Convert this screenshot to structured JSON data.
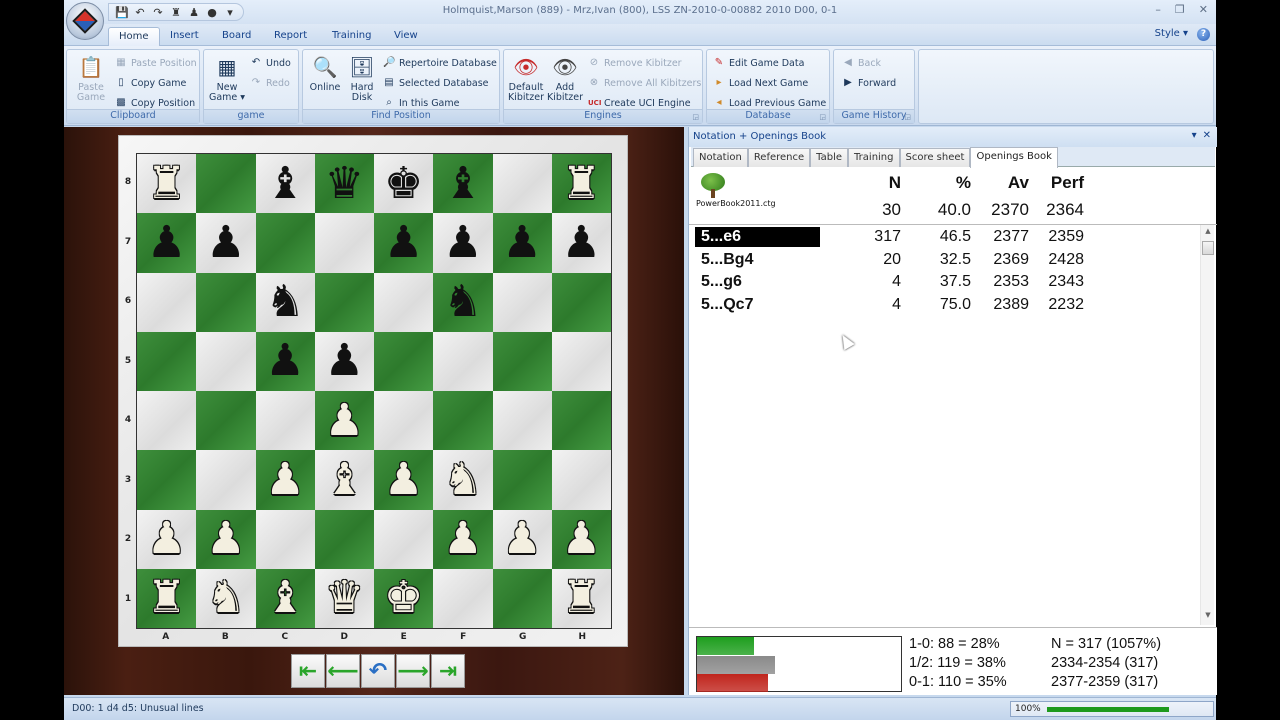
{
  "window": {
    "title": "Holmquist,Marson (889) - Mrz,Ivan (800), LSS ZN-2010-0-00882 2010  D00, 0-1",
    "controls": [
      "minimize",
      "restore",
      "close"
    ]
  },
  "quick_access": [
    {
      "icon": "save-icon",
      "glyph": "💾"
    },
    {
      "icon": "undo-icon",
      "glyph": "↶"
    },
    {
      "icon": "redo-icon",
      "glyph": "↷"
    },
    {
      "icon": "board-icon",
      "glyph": "♜"
    },
    {
      "icon": "piece-icon",
      "glyph": "♟"
    },
    {
      "icon": "bulb-icon",
      "glyph": "●"
    },
    {
      "icon": "customize-icon",
      "glyph": "▾"
    }
  ],
  "ribbon": {
    "tabs": [
      {
        "label": "Home",
        "active": true
      },
      {
        "label": "Insert",
        "active": false
      },
      {
        "label": "Board",
        "active": false
      },
      {
        "label": "Report",
        "active": false
      },
      {
        "label": "Training",
        "active": false
      },
      {
        "label": "View",
        "active": false
      }
    ],
    "style_label": "Style",
    "groups": {
      "clipboard": {
        "label": "Clipboard",
        "paste_game": "Paste Game",
        "paste_game_l1": "Paste",
        "paste_game_l2": "Game",
        "paste_position": "Paste Position",
        "copy_game": "Copy Game",
        "copy_position": "Copy Position"
      },
      "game": {
        "label": "game",
        "new_game_l1": "New",
        "new_game_l2": "Game ▾",
        "undo": "Undo",
        "redo": "Redo"
      },
      "find_position": {
        "label": "Find Position",
        "online": "Online",
        "hard_disk_l1": "Hard",
        "hard_disk_l2": "Disk",
        "repertoire_db": "Repertoire Database",
        "selected_db": "Selected Database",
        "in_this_game": "In this Game"
      },
      "engines": {
        "label": "Engines",
        "default_kibitzer_l1": "Default",
        "default_kibitzer_l2": "Kibitzer",
        "add_kibitzer_l1": "Add",
        "add_kibitzer_l2": "Kibitzer",
        "remove_kibitzer": "Remove Kibitzer",
        "remove_all_kibitzers": "Remove All Kibitzers",
        "create_uci_engine": "Create UCI Engine"
      },
      "database": {
        "label": "Database",
        "edit_game_data": "Edit Game Data",
        "load_next_game": "Load Next Game",
        "load_previous_game": "Load Previous Game"
      },
      "game_history": {
        "label": "Game History",
        "back": "Back",
        "forward": "Forward"
      }
    }
  },
  "board": {
    "ranks": [
      "8",
      "7",
      "6",
      "5",
      "4",
      "3",
      "2",
      "1"
    ],
    "files": [
      "A",
      "B",
      "C",
      "D",
      "E",
      "F",
      "G",
      "H"
    ],
    "position": [
      [
        "wR",
        "",
        "bB",
        "bQ",
        "bK",
        "bB",
        "",
        "wR"
      ],
      [
        "bP",
        "bP",
        "",
        "",
        "bP",
        "bP",
        "bP",
        "bP"
      ],
      [
        "",
        "",
        "bN",
        "",
        "",
        "bN",
        "",
        ""
      ],
      [
        "",
        "",
        "bP",
        "bP",
        "",
        "",
        "",
        ""
      ],
      [
        "",
        "",
        "",
        "wP",
        "",
        "",
        "",
        ""
      ],
      [
        "",
        "",
        "wP",
        "wB",
        "wP",
        "wN",
        "",
        ""
      ],
      [
        "wP",
        "wP",
        "",
        "",
        "",
        "wP",
        "wP",
        "wP"
      ],
      [
        "wR",
        "wN",
        "wB",
        "wQ",
        "wK",
        "",
        "",
        "wR"
      ]
    ],
    "nav_buttons": [
      {
        "name": "first-move-button",
        "icon": "first-move-icon",
        "glyph": "⇤"
      },
      {
        "name": "previous-move-button",
        "icon": "arrow-left-icon",
        "glyph": "⟵"
      },
      {
        "name": "takeback-button",
        "icon": "undo-arrow-icon",
        "glyph": "↶"
      },
      {
        "name": "next-move-button",
        "icon": "arrow-right-icon",
        "glyph": "⟶"
      },
      {
        "name": "last-move-button",
        "icon": "last-move-icon",
        "glyph": "⇥"
      }
    ]
  },
  "panel": {
    "title": "Notation + Openings Book",
    "tabs": [
      {
        "label": "Notation",
        "active": false
      },
      {
        "label": "Reference",
        "active": false
      },
      {
        "label": "Table",
        "active": false
      },
      {
        "label": "Training",
        "active": false
      },
      {
        "label": "Score sheet",
        "active": false
      },
      {
        "label": "Openings Book",
        "active": true
      }
    ],
    "book": {
      "name": "PowerBook2011.ctg",
      "headers": {
        "n": "N",
        "pct": "%",
        "av": "Av",
        "perf": "Perf"
      },
      "totals": {
        "n": "30",
        "pct": "40.0",
        "av": "2370",
        "perf": "2364"
      }
    },
    "moves": [
      {
        "move": "5...e6",
        "n": "317",
        "pct": "46.5",
        "av": "2377",
        "perf": "2359",
        "selected": true
      },
      {
        "move": "5...Bg4",
        "n": "20",
        "pct": "32.5",
        "av": "2369",
        "perf": "2428",
        "selected": false
      },
      {
        "move": "5...g6",
        "n": "4",
        "pct": "37.5",
        "av": "2353",
        "perf": "2343",
        "selected": false
      },
      {
        "move": "5...Qc7",
        "n": "4",
        "pct": "75.0",
        "av": "2389",
        "perf": "2232",
        "selected": false
      }
    ],
    "stats": {
      "results": [
        {
          "label": "1-0:  88 = 28%",
          "fraction": 0.28,
          "color": "#1e9e1e"
        },
        {
          "label": "1/2:  119 = 38%",
          "fraction": 0.38,
          "color": "#8a8a8a"
        },
        {
          "label": "0-1:  110 = 35%",
          "fraction": 0.35,
          "color": "#c0251d"
        }
      ],
      "summary": [
        "N = 317 (1057%)",
        "2334-2354 (317)",
        "2377-2359 (317)"
      ]
    }
  },
  "statusbar": {
    "text": "D00: 1 d4 d5: Unusual lines",
    "zoom_label": "100%",
    "progress": 1.0
  }
}
